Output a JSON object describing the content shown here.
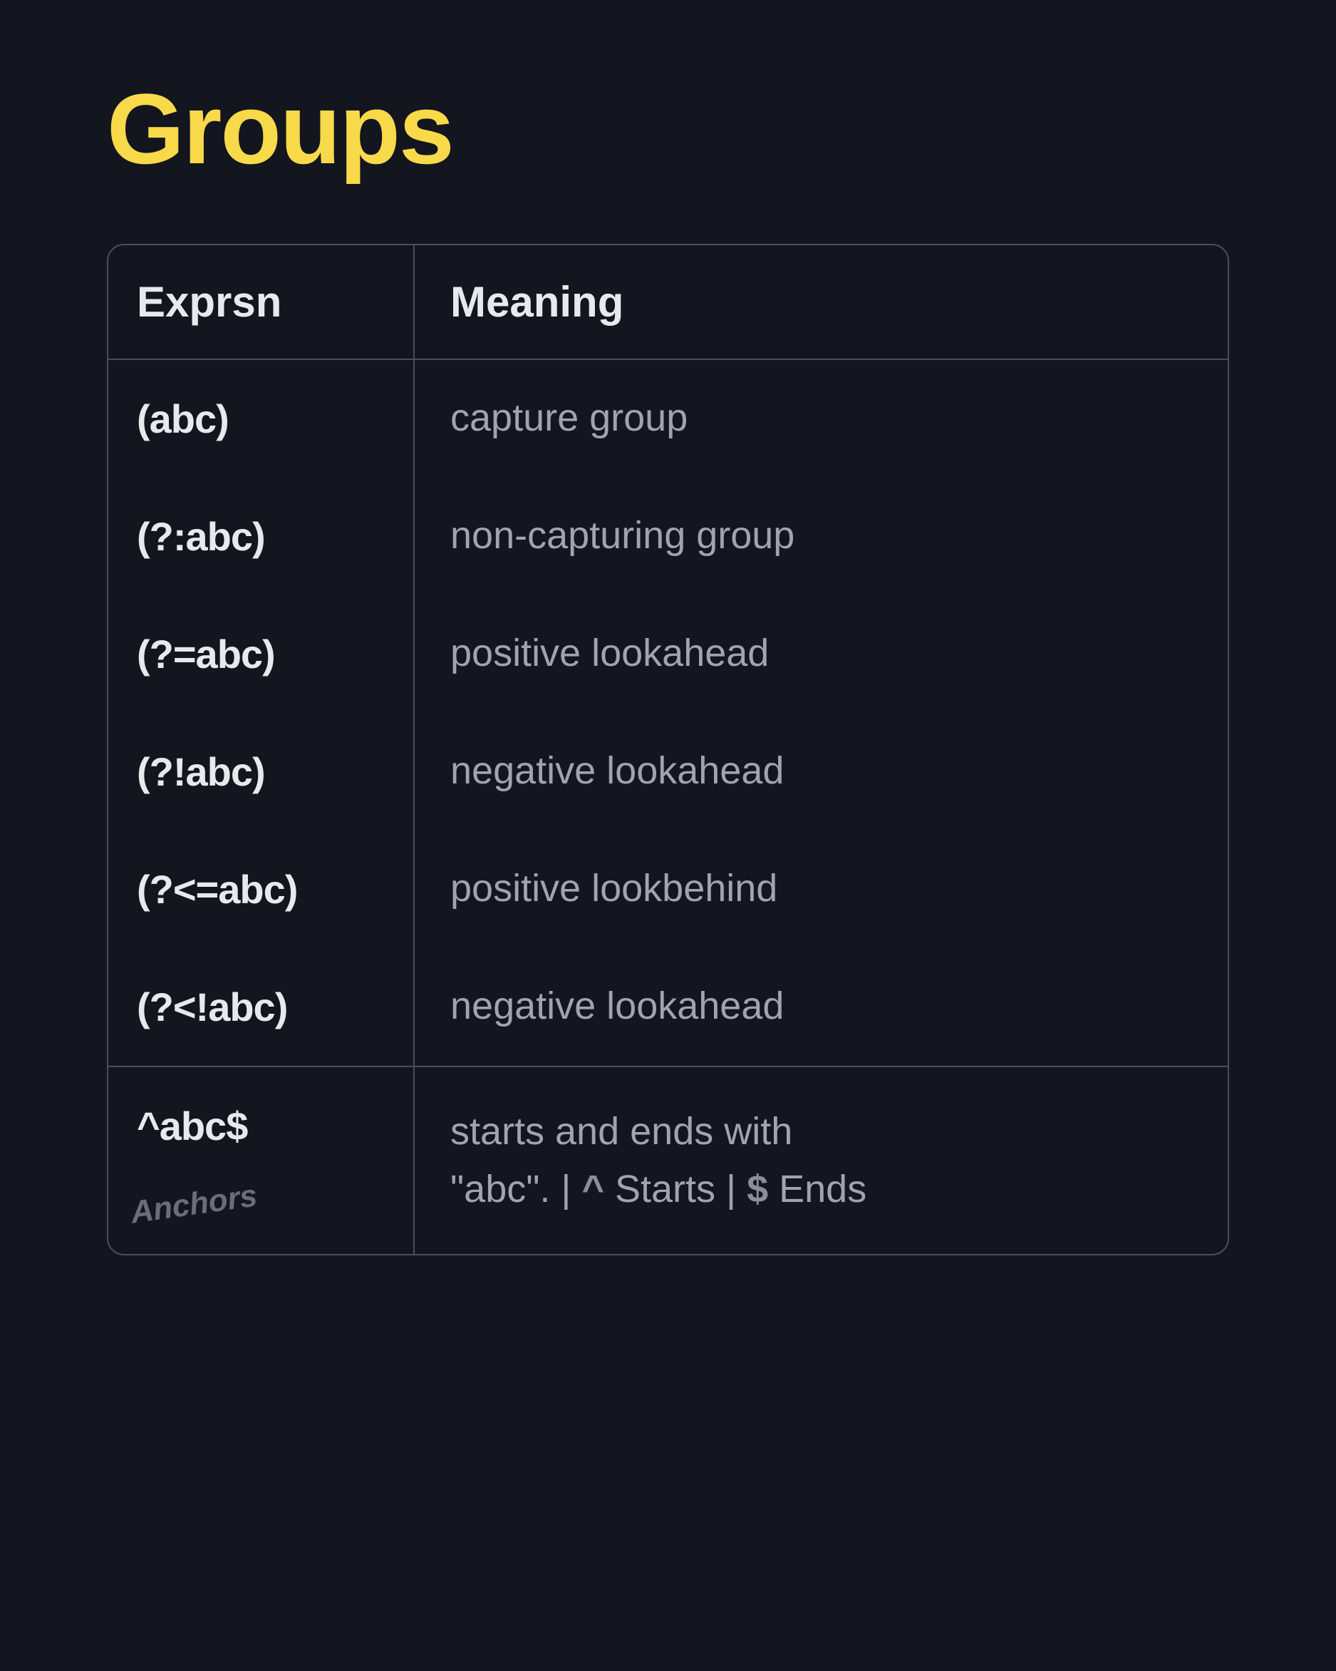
{
  "title": "Groups",
  "headers": {
    "exprsn": "Exprsn",
    "meaning": "Meaning"
  },
  "rows": [
    {
      "exprsn": "(abc)",
      "meaning": "capture group"
    },
    {
      "exprsn": "(?:abc)",
      "meaning": "non-capturing group"
    },
    {
      "exprsn": "(?=abc)",
      "meaning": "positive lookahead"
    },
    {
      "exprsn": "(?!abc)",
      "meaning": "negative lookahead"
    },
    {
      "exprsn": "(?<=abc)",
      "meaning": "positive lookbehind"
    },
    {
      "exprsn": "(?<!abc)",
      "meaning": "negative lookahead"
    }
  ],
  "anchors": {
    "exprsn": "^abc$",
    "label": "Anchors",
    "meaning_line1": "starts and ends with",
    "meaning_line2_prefix": "\"abc\".  | ",
    "caret_sym": "^",
    "starts_text": " Starts | ",
    "dollar_sym": "$",
    "ends_text": " Ends"
  }
}
